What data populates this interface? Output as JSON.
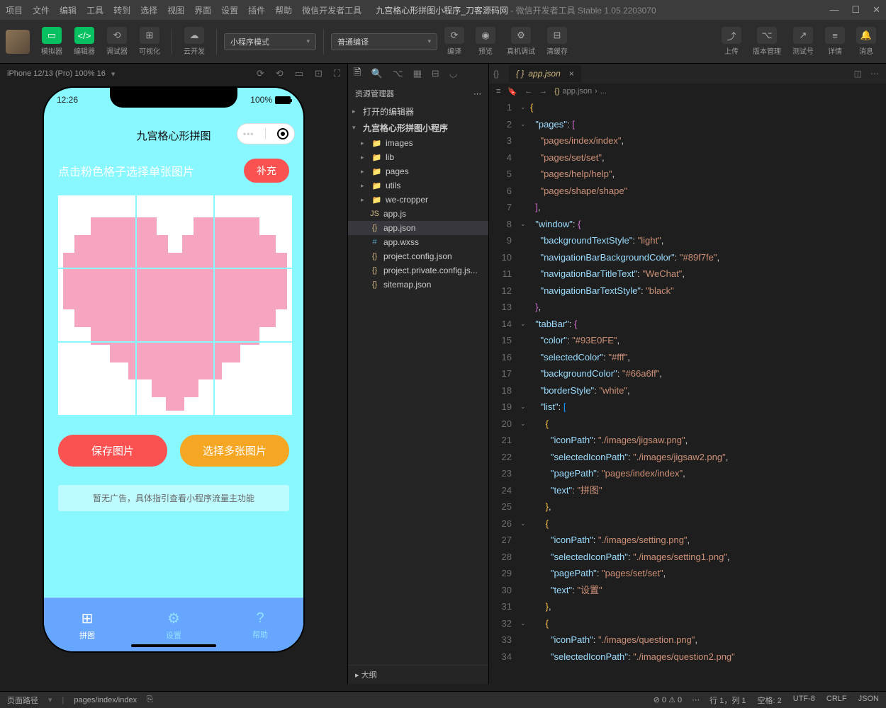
{
  "title": {
    "doc": "九宫格心形拼图小程序_刀客源码网",
    "app": "微信开发者工具 Stable 1.05.2203070"
  },
  "menu": [
    "项目",
    "文件",
    "编辑",
    "工具",
    "转到",
    "选择",
    "视图",
    "界面",
    "设置",
    "插件",
    "帮助",
    "微信开发者工具"
  ],
  "toolbar": {
    "sim": "模拟器",
    "editor": "编辑器",
    "debug": "调试器",
    "visual": "可视化",
    "cloud": "云开发",
    "mode": "小程序模式",
    "compile": "普通编译",
    "compileBtn": "编译",
    "preview": "预览",
    "realdbg": "真机调试",
    "clearcache": "清缓存",
    "upload": "上传",
    "version": "版本管理",
    "testno": "测试号",
    "detail": "详情",
    "msg": "消息"
  },
  "sim": {
    "device": "iPhone 12/13 (Pro) 100% 16",
    "time": "12:26",
    "battery": "100%"
  },
  "app": {
    "title": "九宫格心形拼图",
    "hint": "点击粉色格子选择单张图片",
    "fill": "补充",
    "save": "保存图片",
    "multi": "选择多张图片",
    "ad": "暂无广告，具体指引查看小程序流量主功能",
    "tabs": [
      "拼图",
      "设置",
      "帮助"
    ]
  },
  "explorer": {
    "title": "资源管理器",
    "openEditors": "打开的编辑器",
    "project": "九宫格心形拼图小程序",
    "folders": [
      "images",
      "lib",
      "pages",
      "utils",
      "we-cropper"
    ],
    "files": [
      {
        "n": "app.js",
        "c": "fyel",
        "i": "JS"
      },
      {
        "n": "app.json",
        "c": "fyel",
        "i": "{}",
        "sel": true
      },
      {
        "n": "app.wxss",
        "c": "fblu",
        "i": "#"
      },
      {
        "n": "project.config.json",
        "c": "fyel",
        "i": "{}"
      },
      {
        "n": "project.private.config.js...",
        "c": "fyel",
        "i": "{}"
      },
      {
        "n": "sitemap.json",
        "c": "fyel",
        "i": "{}"
      }
    ],
    "outline": "大纲"
  },
  "editor": {
    "tab": "app.json",
    "crumb": "app.json"
  },
  "json": {
    "pages": [
      "pages/index/index",
      "pages/set/set",
      "pages/help/help",
      "pages/shape/shape"
    ],
    "window": {
      "backgroundTextStyle": "light",
      "navigationBarBackgroundColor": "#89f7fe",
      "navigationBarTitleText": "WeChat",
      "navigationBarTextStyle": "black"
    },
    "tabBar": {
      "color": "#93E0FE",
      "selectedColor": "#fff",
      "backgroundColor": "#66a6ff",
      "borderStyle": "white",
      "list": [
        {
          "iconPath": "./images/jigsaw.png",
          "selectedIconPath": "./images/jigsaw2.png",
          "pagePath": "pages/index/index",
          "text": "拼图"
        },
        {
          "iconPath": "./images/setting.png",
          "selectedIconPath": "./images/setting1.png",
          "pagePath": "pages/set/set",
          "text": "设置"
        },
        {
          "iconPath": "./images/question.png",
          "selectedIconPath": "./images/question2.png"
        }
      ]
    }
  },
  "status": {
    "pathLabel": "页面路径",
    "path": "pages/index/index",
    "err": "0",
    "warn": "0",
    "ln": "行 1，列 1",
    "spaces": "空格: 2",
    "enc": "UTF-8",
    "eol": "CRLF",
    "lang": "JSON"
  }
}
